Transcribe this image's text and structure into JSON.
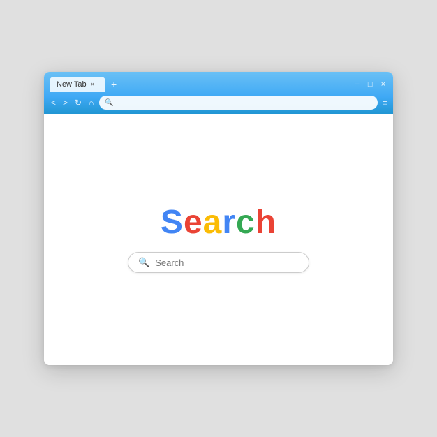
{
  "browser": {
    "tab": {
      "label": "New Tab",
      "close": "×",
      "new": "+"
    },
    "window_controls": {
      "minimize": "−",
      "maximize": "□",
      "close": "×"
    },
    "nav": {
      "back": "<",
      "forward": ">",
      "refresh": "↻",
      "home": "⌂"
    },
    "address": {
      "text": ""
    },
    "menu": "≡"
  },
  "page": {
    "logo": {
      "letters": [
        "S",
        "e",
        "a",
        "r",
        "c",
        "h"
      ]
    },
    "search_input_placeholder": "Search"
  }
}
